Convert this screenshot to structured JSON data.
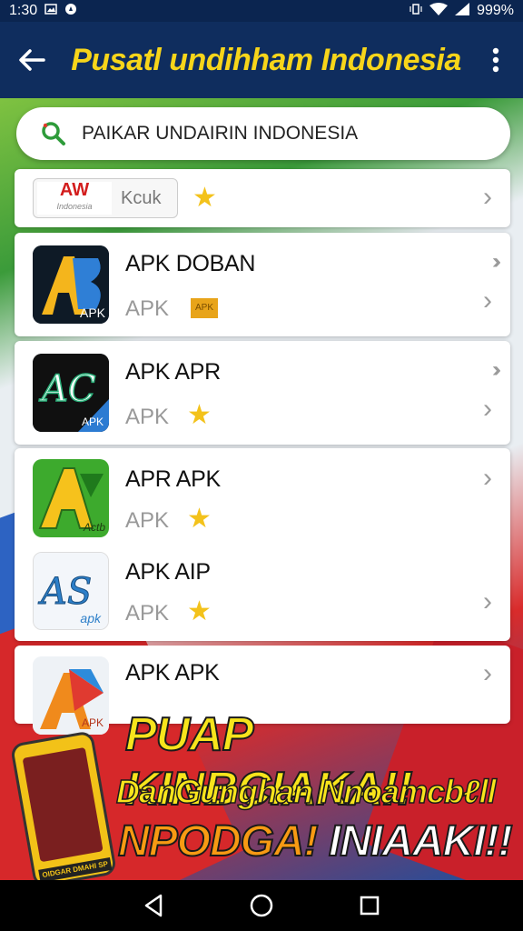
{
  "status": {
    "time": "1:30",
    "battery": "999%"
  },
  "header": {
    "title": "Pusatl undihham Indonesia"
  },
  "search": {
    "value": "PAIKAR UNDAIRIN INDONESIA"
  },
  "list": {
    "top": {
      "logo_text": "AW",
      "logo_sub": "Indonesia",
      "label": "Kcuk"
    },
    "items": [
      {
        "name": "APK DOBAN",
        "sub": "APK",
        "badge": "APK",
        "icon_text": "AB",
        "icon_sub": "APK"
      },
      {
        "name": "APK APR",
        "sub": "APK",
        "icon_text": "AC",
        "icon_sub": "APK"
      },
      {
        "name": "APR APK",
        "sub": "APK",
        "icon_text": "A",
        "icon_sub": "Actb"
      },
      {
        "name": "APK AIP",
        "sub": "APK",
        "icon_text": "AS",
        "icon_sub": "apk"
      },
      {
        "name": "APK APK",
        "sub": "",
        "icon_text": "A",
        "icon_sub": "APK"
      }
    ]
  },
  "promo": {
    "line1": "PUAP KINBCIAKA!!",
    "line2": "DanGunghan Nnoamcbℓll",
    "line3a": "NPODGA!",
    "line3b": "INIAAKI!!",
    "phone_tag": "OIDGAR DMAHI SP"
  },
  "colors": {
    "appbar": "#0f2d5e",
    "title": "#f7d51a",
    "star": "#f3c21b"
  }
}
